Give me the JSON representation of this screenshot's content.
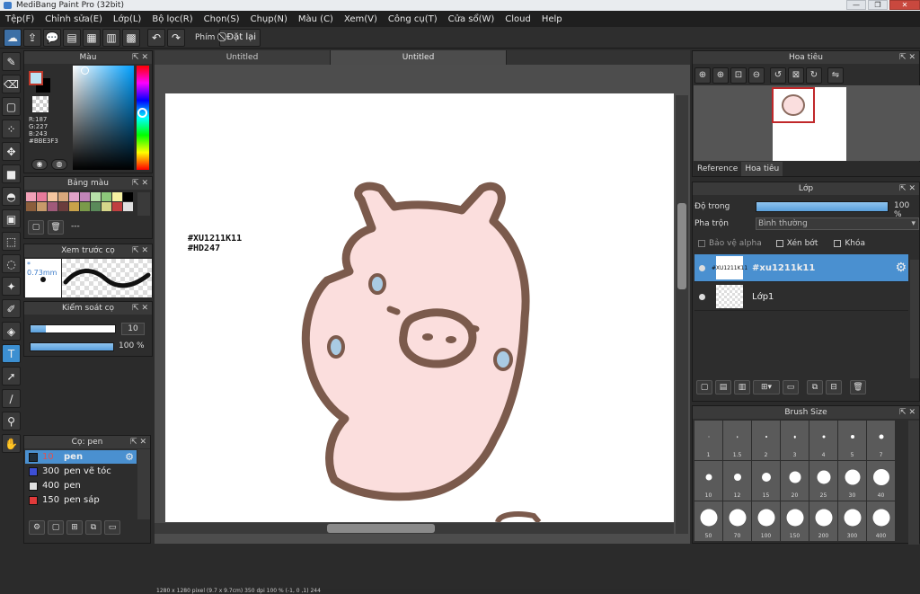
{
  "titlebar": {
    "title": "MediBang Paint Pro (32bit)",
    "minimize": "—",
    "maximize": "❐",
    "close": "✕"
  },
  "menu": [
    "Tệp(F)",
    "Chỉnh sửa(E)",
    "Lớp(L)",
    "Bộ lọc(R)",
    "Chọn(S)",
    "Chụp(N)",
    "Màu (C)",
    "Xem(V)",
    "Công cụ(T)",
    "Cửa sổ(W)",
    "Cloud",
    "Help"
  ],
  "toolbar": {
    "key_label": "Phím",
    "reset_label": "Đặt lại"
  },
  "color_panel": {
    "title": "Màu",
    "r": "R:187",
    "g": "G:227",
    "b": "B:243",
    "hex": "#BBE3F3",
    "fg_color": "#bbe3f3",
    "bg_color": "#000000"
  },
  "palette_panel": {
    "title": "Bảng màu",
    "label": "---",
    "colors": [
      "#f2a1b8",
      "#e87b9b",
      "#f5c6a0",
      "#d9a87c",
      "#e0a3c7",
      "#c084b8",
      "#b6e0a8",
      "#8cc77a",
      "#f6f2a2",
      "#000000",
      "#8b5e3c",
      "#c79a6a",
      "#a05a7a",
      "#6b3d3d",
      "#c9a24a",
      "#7a9a4a",
      "#5a8a5a",
      "#d6d68a",
      "#c04040",
      "#e0e0e0"
    ]
  },
  "preview_panel": {
    "title": "Xem trước cọ",
    "size": "* 0.73mm"
  },
  "control_panel": {
    "title": "Kiểm soát cọ",
    "size_value": "10",
    "size_fraction": 0.18,
    "opacity_value": "100 %",
    "opacity_fraction": 1.0
  },
  "brush_panel": {
    "title": "Cọ: pen",
    "brushes": [
      {
        "size": "10",
        "name": "pen",
        "color": "#1f2d3a"
      },
      {
        "size": "300",
        "name": "pen vẽ tóc",
        "color": "#3d4fd6"
      },
      {
        "size": "400",
        "name": "pen",
        "color": "#e0e0e0"
      },
      {
        "size": "150",
        "name": "pen sáp",
        "color": "#e03a3a"
      }
    ]
  },
  "tabs": [
    "Untitled",
    "Untitled"
  ],
  "canvas": {
    "hashtag_line1": "#XU1211K11",
    "hashtag_line2": "#HD247"
  },
  "statusbar": {
    "text": "1280 x 1280 pixel (9.7 x 9.7cm) 350 dpi 100 % (-1, 0 ,1) 244"
  },
  "navigator": {
    "title": "Hoa tiêu",
    "tab_reference": "Reference",
    "tab_navigator": "Hoa tiêu"
  },
  "layer_panel": {
    "title": "Lớp",
    "opacity_label": "Độ trong",
    "opacity_value": "100 %",
    "opacity_fraction": 1.0,
    "blend_label": "Pha trộn",
    "blend_value": "Bình thường",
    "protect_alpha": "Bảo vệ alpha",
    "clipping": "Xén bớt",
    "lock": "Khóa",
    "layers": [
      {
        "name": "#xu1211k11",
        "thumb": "#XU1211K11"
      },
      {
        "name": "Lớp1",
        "thumb": ""
      }
    ]
  },
  "brush_size_panel": {
    "title": "Brush Size",
    "sizes": [
      "1",
      "1.5",
      "2",
      "3",
      "4",
      "5",
      "7",
      "10",
      "12",
      "15",
      "20",
      "25",
      "30",
      "40",
      "50",
      "70",
      "100",
      "150",
      "200",
      "300",
      "400"
    ]
  }
}
